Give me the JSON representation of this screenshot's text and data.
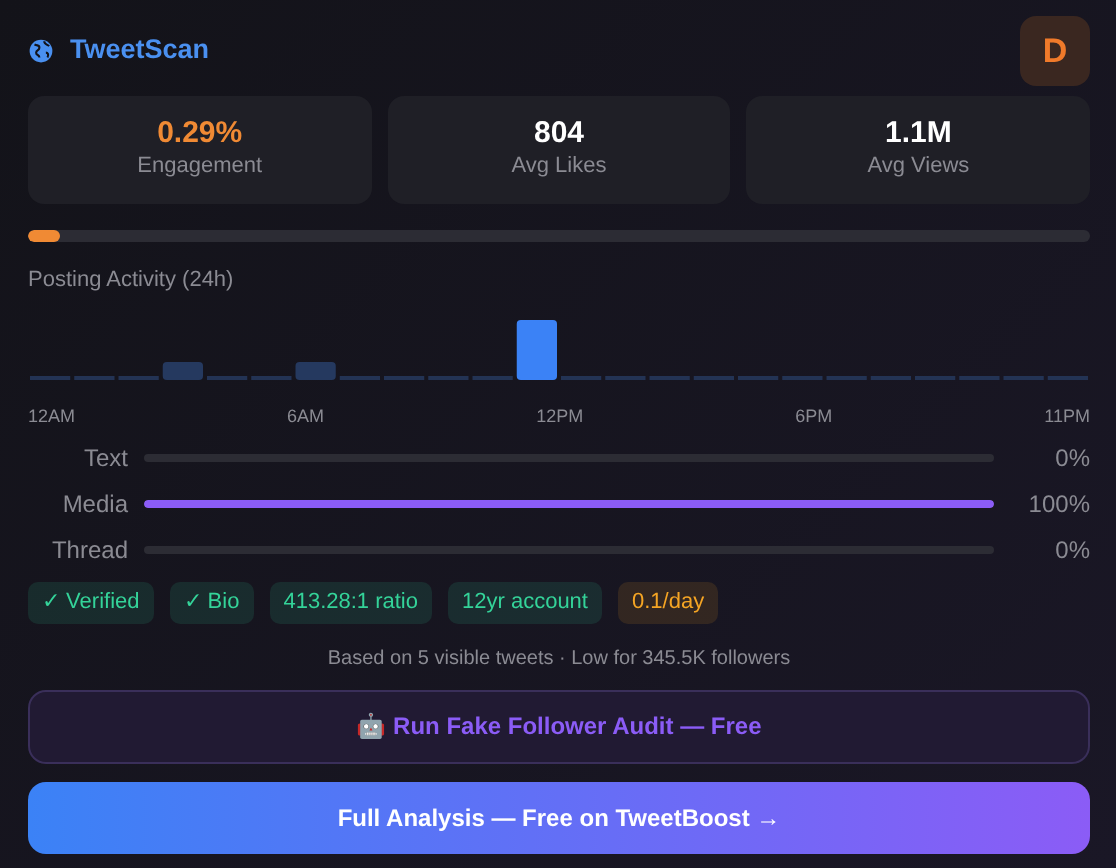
{
  "header": {
    "title": "TweetScan",
    "avatar": "D"
  },
  "stats": [
    {
      "value": "0.29%",
      "label": "Engagement",
      "highlight": true
    },
    {
      "value": "804",
      "label": "Avg Likes",
      "highlight": false
    },
    {
      "value": "1.1M",
      "label": "Avg Views",
      "highlight": false
    }
  ],
  "engagement_bar": {
    "level": 0.03
  },
  "activity": {
    "title": "Posting Activity (24h)",
    "axis_labels": [
      "12AM",
      "6AM",
      "12PM",
      "6PM",
      "11PM"
    ]
  },
  "content_types": [
    {
      "label": "Text",
      "level": 0,
      "reading": "0%"
    },
    {
      "label": "Media",
      "level": 1,
      "reading": "100%"
    },
    {
      "label": "Thread",
      "level": 0,
      "reading": "0%"
    }
  ],
  "tags": [
    {
      "text": "✓ Verified",
      "color": "#34d399"
    },
    {
      "text": "✓ Bio",
      "color": "#34d399"
    },
    {
      "text": "413.28:1 ratio",
      "color": "#34d399"
    },
    {
      "text": "12yr account",
      "color": "#34d399"
    },
    {
      "text": "0.1/day",
      "color": "#f5a524"
    }
  ],
  "note": "Based on 5 visible tweets · Low for 345.5K followers",
  "buttons": [
    {
      "kind": "audit",
      "text": "🤖 Run Fake Follower Audit — Free"
    },
    {
      "kind": "primary",
      "text": "Full Analysis — Free on TweetBoost →"
    }
  ]
}
